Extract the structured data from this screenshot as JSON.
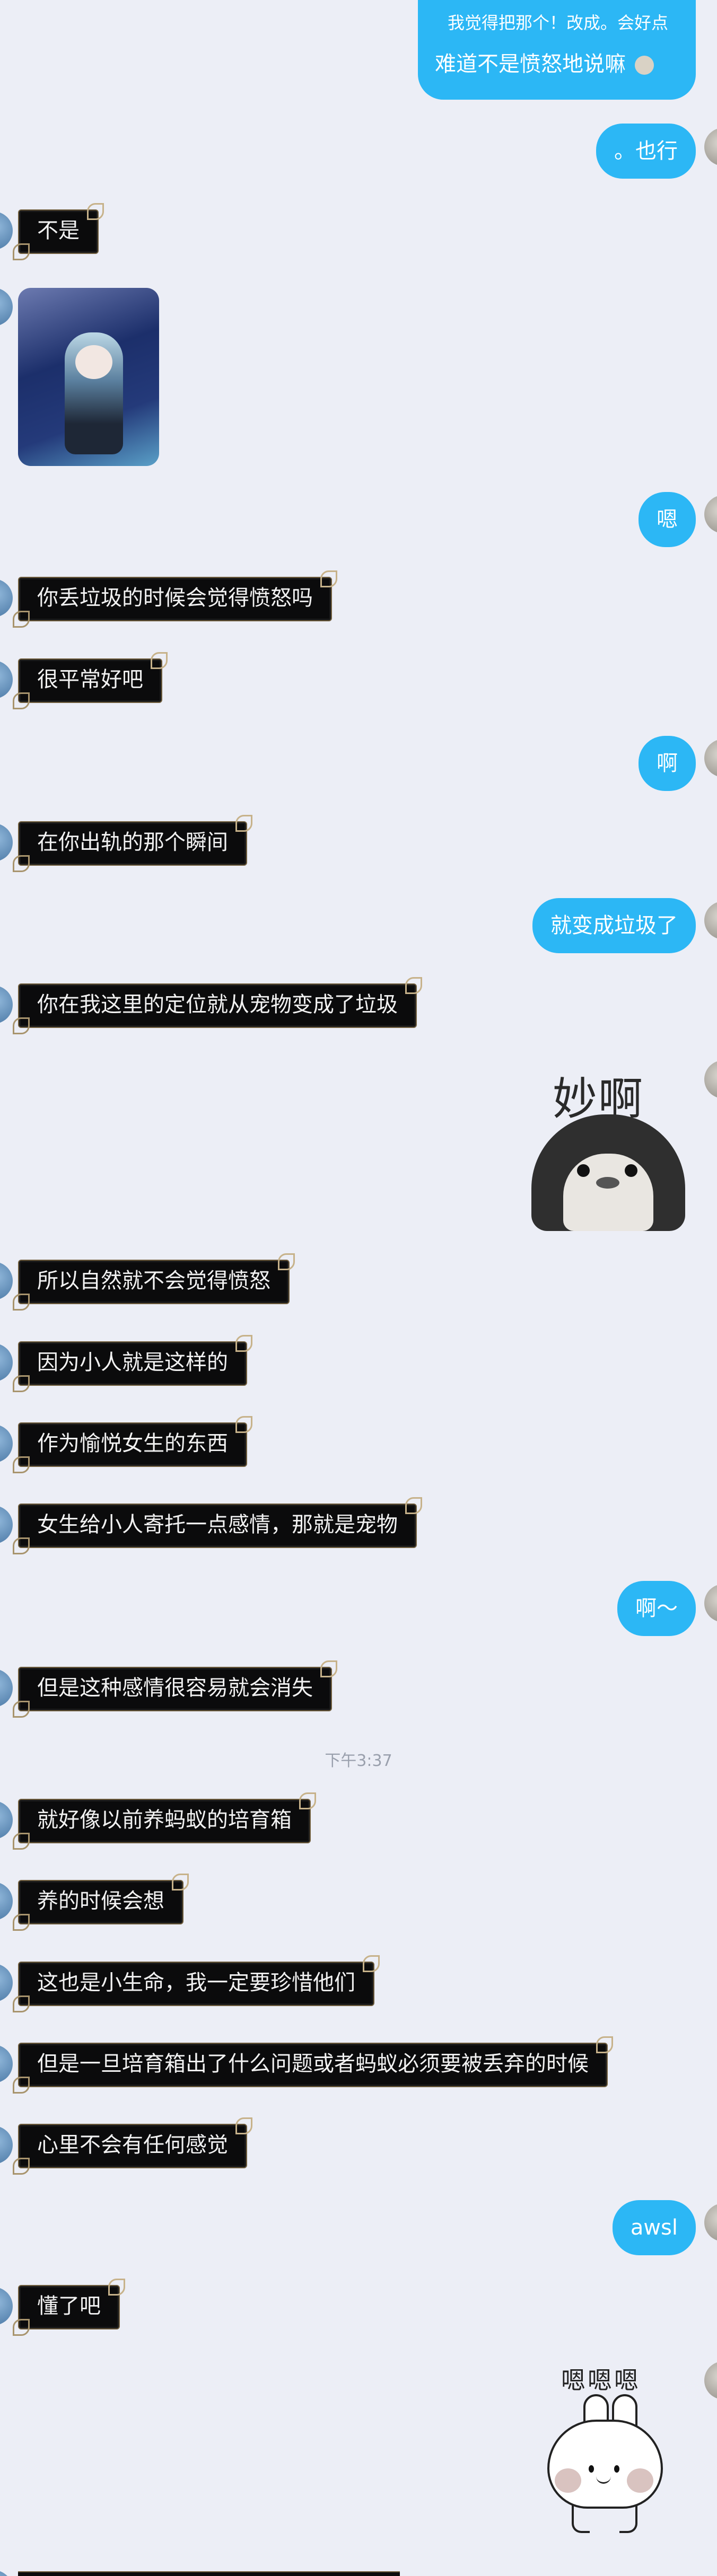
{
  "time_divider": "下午3:37",
  "top_sent": {
    "line1": "我觉得把那个！改成。会好点",
    "line2": "难道不是愤怒地说嘛"
  },
  "sent": {
    "ye_xing": "。也行",
    "en": "嗯",
    "a1": "啊",
    "bian_laji": "就变成垃圾了",
    "a2": "啊～",
    "awsl": "awsl"
  },
  "received": {
    "bu_shi": "不是",
    "diu_laji": "你丢垃圾的时候会觉得愤怒吗",
    "hen_pingchang": "很平常好吧",
    "chugui": "在你出轨的那个瞬间",
    "dingwei": "你在我这里的定位就从宠物变成了垃圾",
    "suoyi": "所以自然就不会觉得愤怒",
    "yinwei": "因为小人就是这样的",
    "zuowei": "作为愉悦女生的东西",
    "nvsheng": "女生给小人寄托一点感情，那就是宠物",
    "danshi": "但是这种感情很容易就会消失",
    "jiuhaoxiang": "就好像以前养蚂蚁的培育箱",
    "yangdeshihou": "养的时候会想",
    "zheyeshi": "这也是小生命，我一定要珍惜他们",
    "yidan": "但是一旦培育箱出了什么问题或者蚂蚁必须要被丢弃的时候",
    "xinli": "心里不会有任何感觉",
    "dongle": "懂了吧"
  },
  "stickers": {
    "penguin_text": "妙啊",
    "bunny_text": "嗯嗯嗯"
  },
  "colors": {
    "background": "#eceef6",
    "sent_bubble": "#2cb7f5",
    "received_bubble": "#0b0b0c",
    "ornament": "#b9a37a"
  }
}
